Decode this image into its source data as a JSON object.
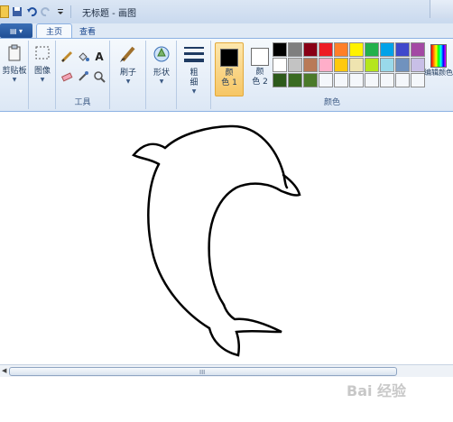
{
  "titlebar": {
    "title": "无标题 - 画图"
  },
  "tabs": {
    "file_menu": "▤ ▾",
    "home": "主页",
    "view": "查看"
  },
  "ribbon": {
    "clipboard": {
      "label": "剪贴板"
    },
    "image": {
      "label": "图像"
    },
    "tools": {
      "label": "工具"
    },
    "brushes": {
      "label": "刷子"
    },
    "shapes": {
      "label": "形状"
    },
    "size": {
      "label_line1": "粗",
      "label_line2": "细"
    },
    "color1": {
      "label_line1": "颜",
      "label_line2": "色 1",
      "color": "#000000"
    },
    "color2": {
      "label_line1": "颜",
      "label_line2": "色 2",
      "color": "#ffffff"
    },
    "colors_group_label": "颜色",
    "edit_colors_label": "编辑颜色"
  },
  "palette": {
    "row1": [
      "#000000",
      "#7f7f7f",
      "#880015",
      "#ed1c24",
      "#ff7f27",
      "#fff200",
      "#22b14c",
      "#00a2e8",
      "#3f48cc",
      "#a349a4"
    ],
    "row2": [
      "#ffffff",
      "#c3c3c3",
      "#b97a57",
      "#ffaec9",
      "#ffc90e",
      "#efe4b0",
      "#b5e61d",
      "#99d9ea",
      "#7092be",
      "#c8bfe7"
    ],
    "row3": [
      "#2d5a1b",
      "#3a6b22",
      "#4b7a2a",
      "#f4f7fb",
      "#f4f7fb",
      "#f4f7fb",
      "#f4f7fb",
      "#f4f7fb",
      "#f4f7fb",
      "#f4f7fb"
    ]
  },
  "status": {
    "scroll_grip": "III"
  },
  "watermark": "Bai 经验"
}
